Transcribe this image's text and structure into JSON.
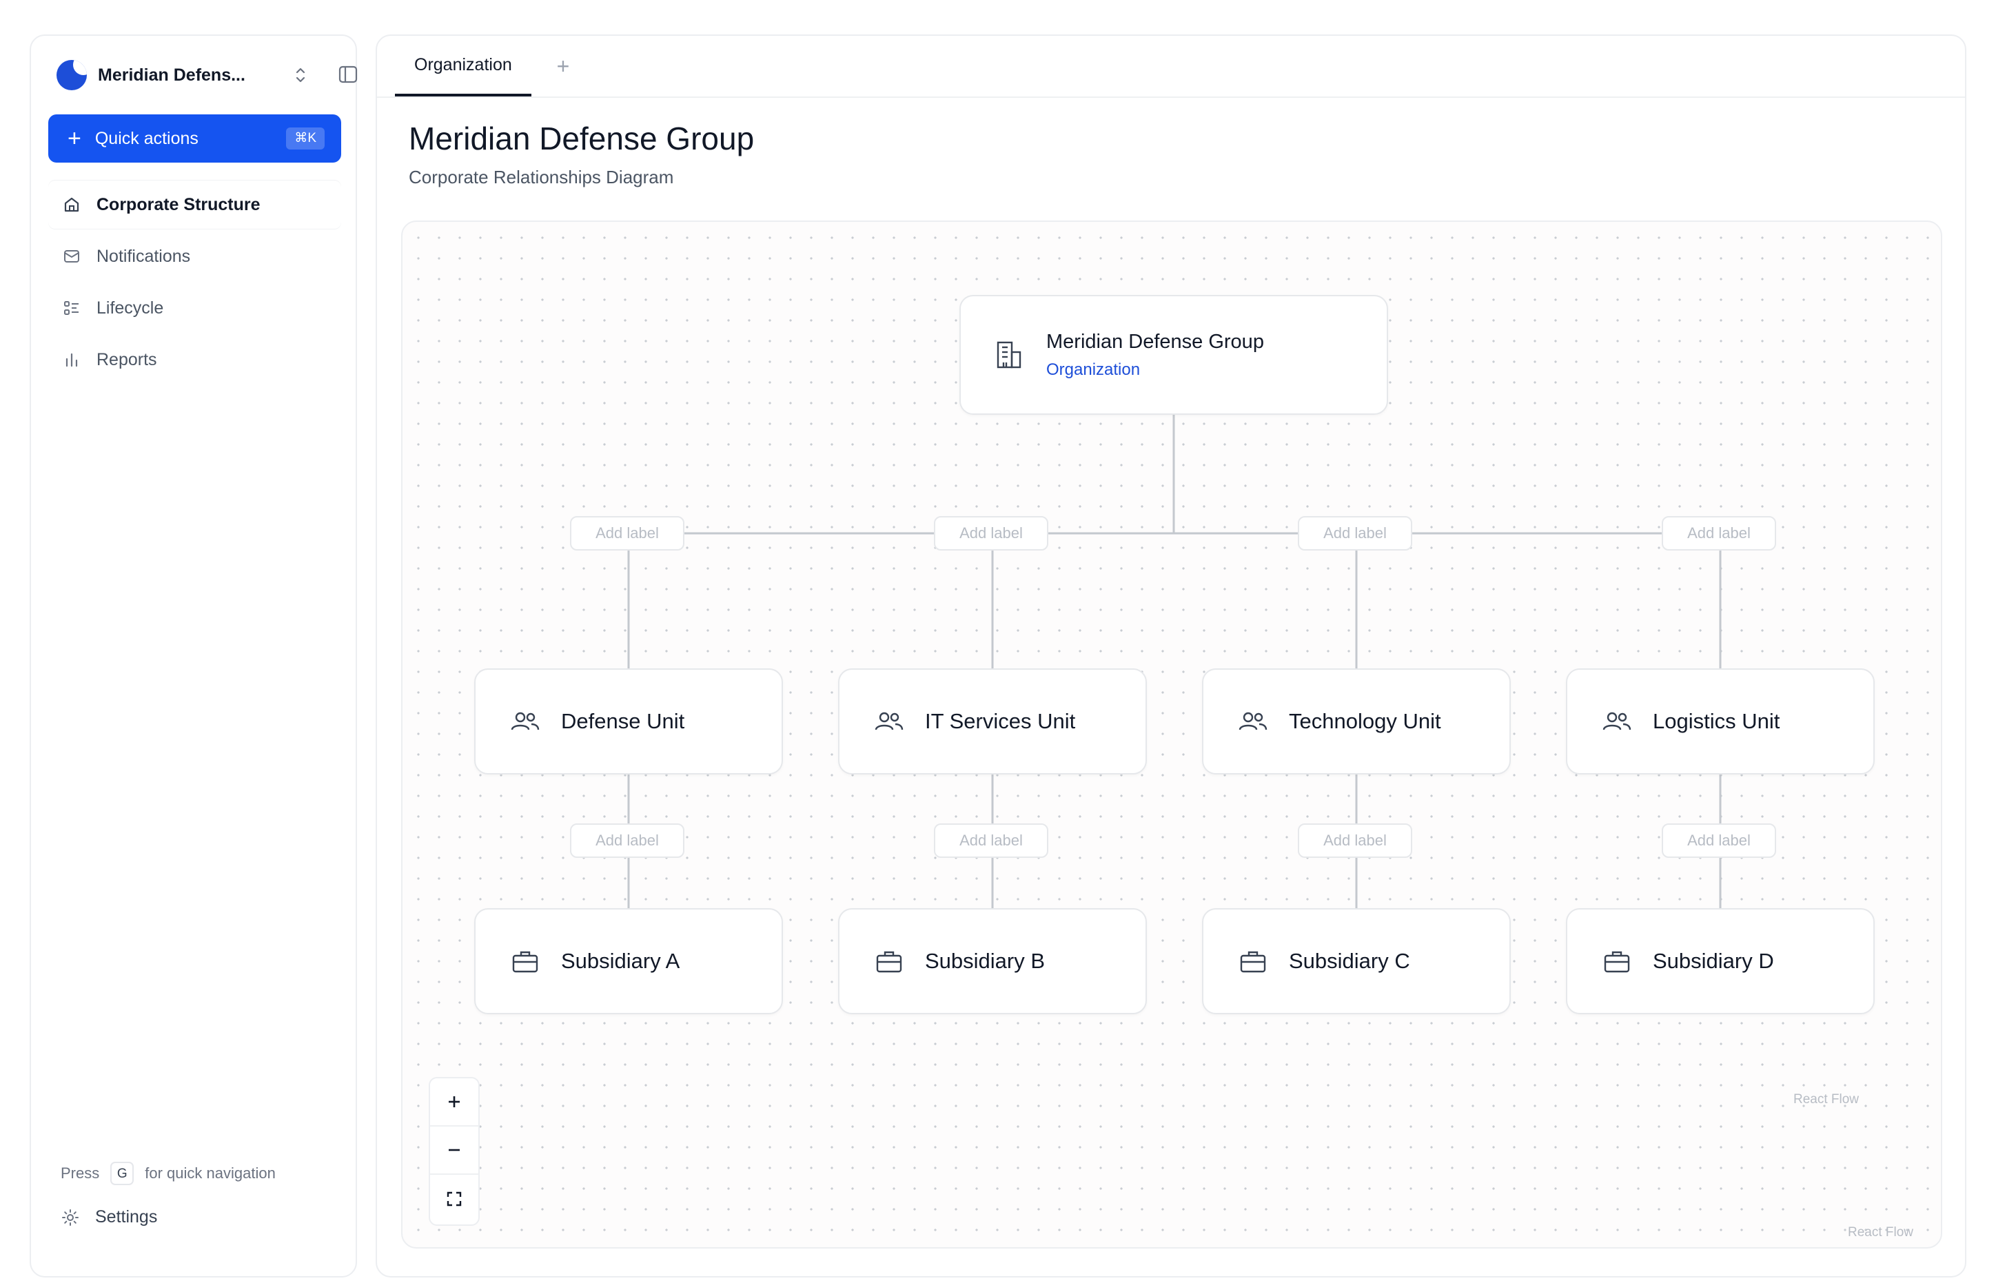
{
  "sidebar": {
    "workspace_name": "Meridian Defens...",
    "quick_actions": {
      "label": "Quick actions",
      "shortcut": "⌘K"
    },
    "items": [
      {
        "label": "Corporate Structure",
        "icon": "home-icon",
        "active": true
      },
      {
        "label": "Notifications",
        "icon": "mail-icon"
      },
      {
        "label": "Lifecycle",
        "icon": "list-icon"
      },
      {
        "label": "Reports",
        "icon": "bar-chart-icon"
      }
    ],
    "hint": {
      "prefix": "Press",
      "key": "G",
      "suffix": "for quick navigation"
    },
    "settings_label": "Settings"
  },
  "tabs": [
    {
      "label": "Organization",
      "active": true
    }
  ],
  "page": {
    "title": "Meridian Defense Group",
    "subtitle": "Corporate Relationships Diagram"
  },
  "diagram": {
    "root": {
      "title": "Meridian Defense Group",
      "type": "Organization",
      "icon": "building-icon"
    },
    "edge_label_placeholder": "Add label",
    "units": [
      {
        "label": "Defense Unit",
        "icon": "users-icon"
      },
      {
        "label": "IT Services Unit",
        "icon": "users-icon"
      },
      {
        "label": "Technology Unit",
        "icon": "users-icon"
      },
      {
        "label": "Logistics Unit",
        "icon": "users-icon"
      }
    ],
    "subsidiaries": [
      {
        "label": "Subsidiary A",
        "icon": "briefcase-icon"
      },
      {
        "label": "Subsidiary B",
        "icon": "briefcase-icon"
      },
      {
        "label": "Subsidiary C",
        "icon": "briefcase-icon"
      },
      {
        "label": "Subsidiary D",
        "icon": "briefcase-icon"
      }
    ],
    "attribution": "React Flow"
  },
  "colors": {
    "accent": "#1554f0",
    "link": "#1d4ed8",
    "edge": "#c4c8ce"
  }
}
